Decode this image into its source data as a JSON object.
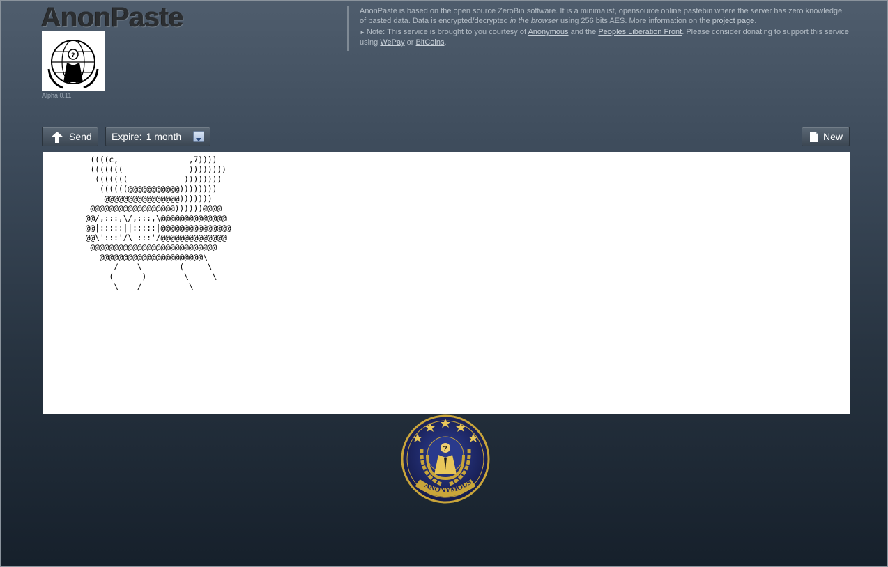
{
  "header": {
    "title": "AnonPaste",
    "version": "Alpha 0.11"
  },
  "info": {
    "line1_pre": "AnonPaste is based on the open source ZeroBin software. It is a minimalist, opensource online pastebin where the server has zero knowledge of pasted data. Data is encrypted/decrypted ",
    "line1_em": "in the browser",
    "line1_mid": " using 256 bits AES. More information on the ",
    "project_link": "project page",
    "line1_end": ".",
    "note_pre": "Note: This service is brought to you courtesy of ",
    "anonymous_link": "Anonymous",
    "note_and": " and the ",
    "plf_link": "Peoples Liberation Front",
    "note_mid": ". Please consider donating to support this service using ",
    "wepay_link": "WePay",
    "note_or": " or ",
    "bitcoins_link": "BitCoins",
    "note_end": "."
  },
  "toolbar": {
    "send_label": "Send",
    "expire_label": "Expire:",
    "expire_value": "1 month",
    "new_label": "New"
  },
  "paste": {
    "content": "  ((((c,               ,7))))\n  (((((((              ))))))))\n   (((((((            ))))))))\n    ((((((@@@@@@@@@@@))))))))\n     @@@@@@@@@@@@@@@@)))))))\n  @@@@@@@@@@@@@@@@@@))))))@@@@\n @@/,:::,\\/,:::,\\@@@@@@@@@@@@@@\n @@|:::::||:::::|@@@@@@@@@@@@@@@\n @@\\':::'/\\':::'/@@@@@@@@@@@@@@\n  @@@@@@@@@@@@@@@@@@@@@@@@@@@\n    @@@@@@@@@@@@@@@@@@@@@@\\\n       /    \\        (     \\\n      (      )        \\     \\\n       \\    /          \\"
  },
  "colors": {
    "accent_gold": "#c9a53a",
    "emblem_navy": "#1f2a6b"
  }
}
